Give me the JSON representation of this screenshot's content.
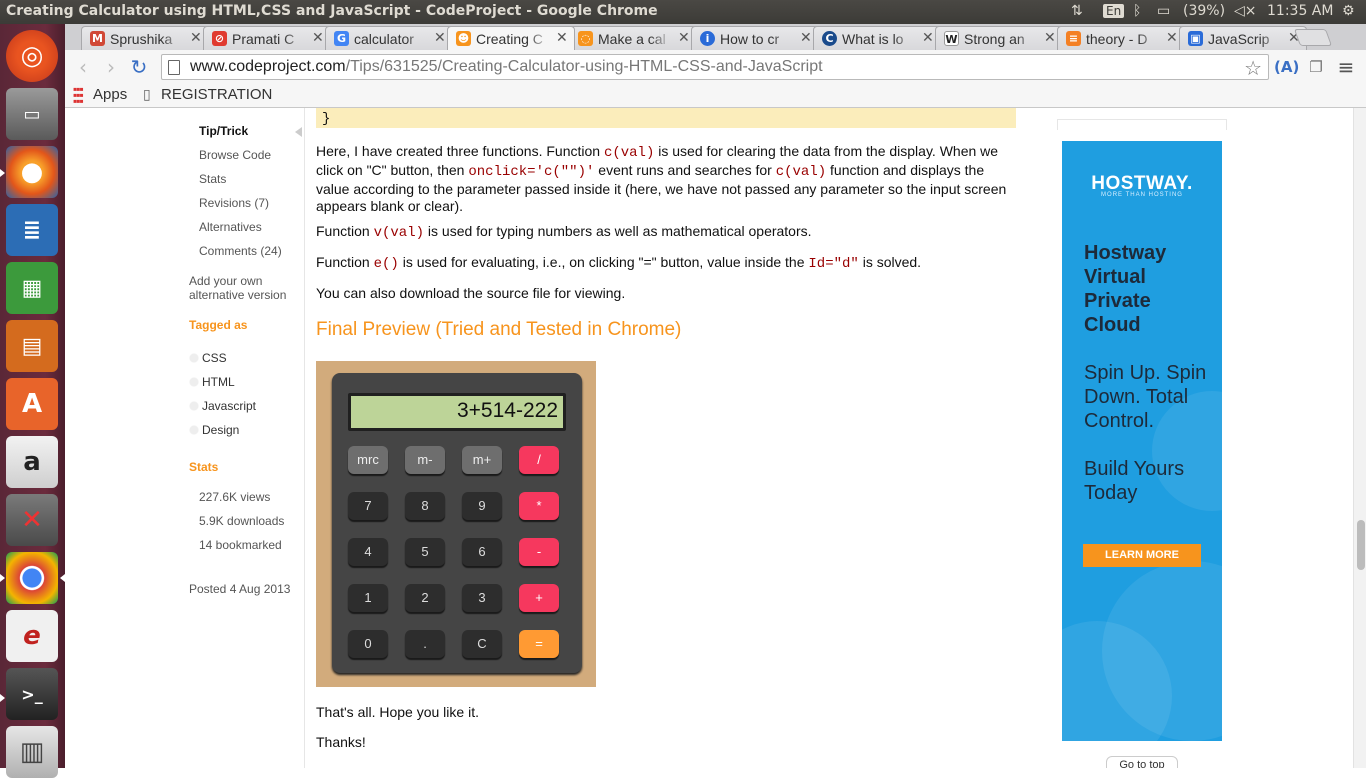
{
  "window": {
    "title": "Creating Calculator using HTML,CSS and JavaScript - CodeProject - Google Chrome",
    "tray": {
      "lang": "En",
      "battery": "(39%)",
      "time": "11:35 AM"
    }
  },
  "tabs": [
    {
      "label": "Sprushika",
      "icon_name": "gmail-icon",
      "icon_color": "#d14836",
      "icon_glyph": "M"
    },
    {
      "label": "Pramati C",
      "icon_name": "pramati-icon",
      "icon_color": "#e03a2f",
      "icon_glyph": "⊘"
    },
    {
      "label": "calculator",
      "icon_name": "google-icon",
      "icon_color": "#4285f4",
      "icon_glyph": "G"
    },
    {
      "label": "Creating C",
      "icon_name": "codeproject-icon",
      "icon_color": "#f7941d",
      "icon_glyph": "☻",
      "active": true
    },
    {
      "label": "Make a cal",
      "icon_name": "loading-icon",
      "icon_color": "#f7941d",
      "icon_glyph": "◌"
    },
    {
      "label": "How to cr",
      "icon_name": "info-icon",
      "icon_color": "#2a6bd8",
      "icon_glyph": "i"
    },
    {
      "label": "What is lo",
      "icon_name": "dark-c-icon",
      "icon_color": "#1a4b8c",
      "icon_glyph": "C"
    },
    {
      "label": "Strong an",
      "icon_name": "wikipedia-icon",
      "icon_color": "#555555",
      "icon_glyph": "W"
    },
    {
      "label": "theory - D",
      "icon_name": "stackexchange-icon",
      "icon_color": "#f48024",
      "icon_glyph": "≡"
    },
    {
      "label": "JavaScrip",
      "icon_name": "chat-icon",
      "icon_color": "#2a6bd8",
      "icon_glyph": "▣"
    }
  ],
  "address": {
    "host": "www.codeproject.com",
    "path": "/Tips/631525/Creating-Calculator-using-HTML-CSS-and-JavaScript"
  },
  "bookmarks": {
    "apps": "Apps",
    "registration": "REGISTRATION"
  },
  "sidebar": {
    "nav": [
      "Tip/Trick",
      "Browse Code",
      "Stats",
      "Revisions (7)",
      "Alternatives",
      "Comments (24)"
    ],
    "add_alt": [
      "Add your own",
      "alternative version"
    ],
    "tagged_heading": "Tagged as",
    "tags": [
      "CSS",
      "HTML",
      "Javascript",
      "Design"
    ],
    "stats_heading": "Stats",
    "stats": [
      "227.6K views",
      "5.9K downloads",
      "14 bookmarked"
    ],
    "posted": "Posted 4 Aug 2013"
  },
  "article": {
    "code_close": "}",
    "p1": {
      "t1": "Here, I have created three functions. Function ",
      "c1": "c(val)",
      "t2": " is used for clearing the data from the display. When we click on \"C\" button, then ",
      "c2": "onclick='c(\"\")'",
      "t3": " event runs and searches for ",
      "c3": "c(val)",
      "t4": " function and displays the value according to the parameter passed inside it (here, we have not passed any parameter so the input screen appears blank or clear)."
    },
    "p2": {
      "t1": "Function ",
      "c1": "v(val)",
      "t2": " is used for typing numbers as well as mathematical operators."
    },
    "p3": {
      "t1": "Function ",
      "c1": "e()",
      "t2": "  is used for evaluating, i.e., on clicking \"=\" button, value inside the ",
      "c2": "Id=\"d\"",
      "t3": "  is solved."
    },
    "p4": "You can also download the source file for viewing.",
    "heading": "Final Preview (Tried and Tested in Chrome)",
    "p5": "That's all. Hope you like it.",
    "p6": "Thanks!"
  },
  "calculator": {
    "display": "3+514-222",
    "rows": [
      [
        {
          "l": "mrc",
          "s": "grey"
        },
        {
          "l": "m-",
          "s": "grey"
        },
        {
          "l": "m+",
          "s": "grey"
        },
        {
          "l": "/",
          "s": "red"
        }
      ],
      [
        {
          "l": "7",
          "s": "dark"
        },
        {
          "l": "8",
          "s": "dark"
        },
        {
          "l": "9",
          "s": "dark"
        },
        {
          "l": "*",
          "s": "red"
        }
      ],
      [
        {
          "l": "4",
          "s": "dark"
        },
        {
          "l": "5",
          "s": "dark"
        },
        {
          "l": "6",
          "s": "dark"
        },
        {
          "l": "-",
          "s": "red"
        }
      ],
      [
        {
          "l": "1",
          "s": "dark"
        },
        {
          "l": "2",
          "s": "dark"
        },
        {
          "l": "3",
          "s": "dark"
        },
        {
          "l": "+",
          "s": "red"
        }
      ],
      [
        {
          "l": "0",
          "s": "dark"
        },
        {
          "l": ".",
          "s": "dark"
        },
        {
          "l": "C",
          "s": "dark"
        },
        {
          "l": "=",
          "s": "orange"
        }
      ]
    ]
  },
  "ad": {
    "logo": "HOSTWAY.",
    "tagline": "MORE THAN HOSTING",
    "headline": "Hostway Virtual Private Cloud",
    "sub": "Spin Up. Spin Down. Total Control.",
    "build": "Build Yours Today",
    "cta": "LEARN MORE"
  },
  "goto_top": "Go to top",
  "colors": {
    "accent": "#f7941d",
    "ad_bg": "#1f9ee0",
    "code": "#990000"
  }
}
